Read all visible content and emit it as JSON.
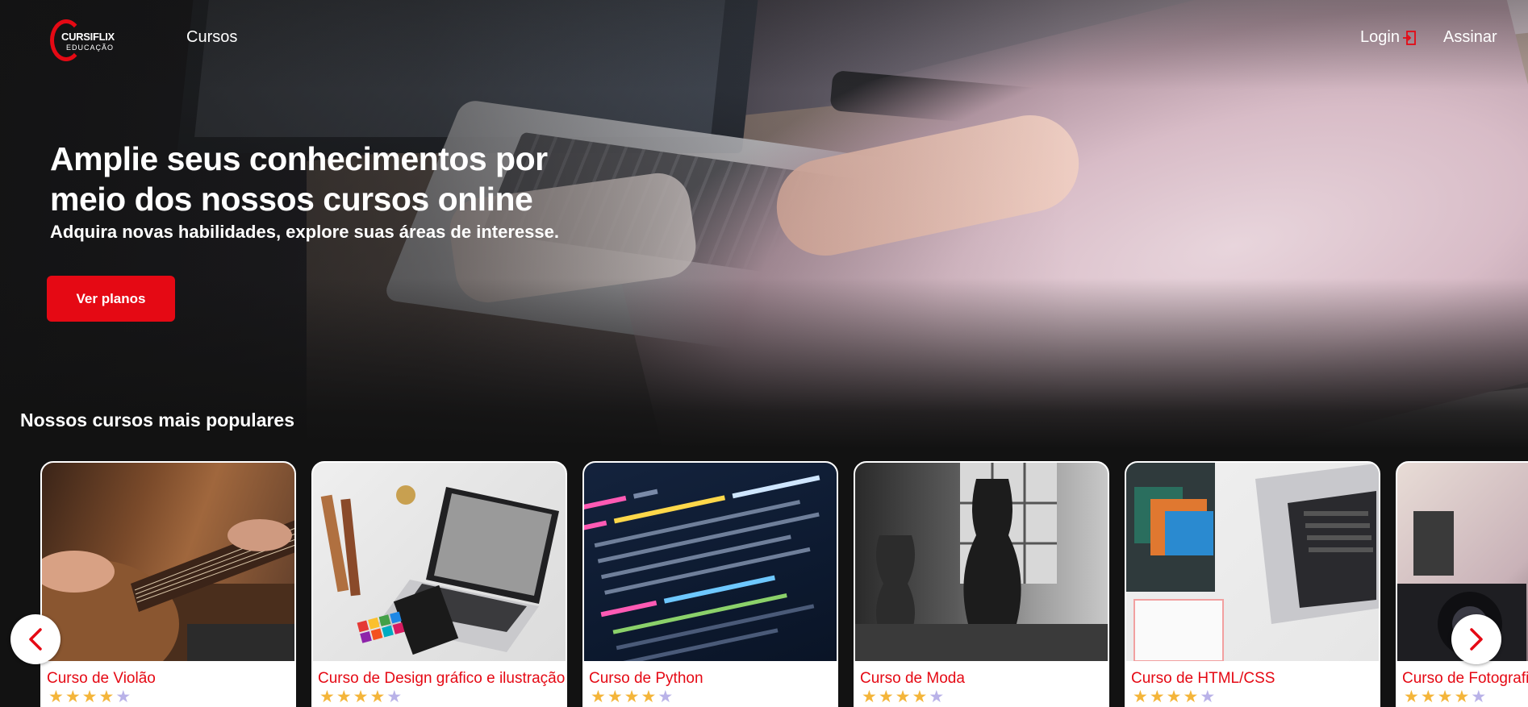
{
  "brand": {
    "top": "CURSIFLIX",
    "bottom": "EDUCAÇÃO",
    "accent": "#e50914"
  },
  "nav": {
    "cursos": "Cursos",
    "login": "Login",
    "login_icon": "login-icon",
    "assinar": "Assinar"
  },
  "hero": {
    "title": "Amplie seus conhecimentos por meio dos nossos cursos online",
    "subtitle": "Adquira novas habilidades, explore suas áreas de interesse.",
    "cta": "Ver planos"
  },
  "section": {
    "title": "Nossos cursos mais populares"
  },
  "courses": [
    {
      "title": "Curso de Violão",
      "rating": 4,
      "max": 5
    },
    {
      "title": "Curso de Design gráfico e ilustração",
      "rating": 4,
      "max": 5
    },
    {
      "title": "Curso de Python",
      "rating": 4,
      "max": 5
    },
    {
      "title": "Curso de Moda",
      "rating": 4,
      "max": 5
    },
    {
      "title": "Curso de HTML/CSS",
      "rating": 4,
      "max": 5
    },
    {
      "title": "Curso de Fotografia",
      "rating": 4,
      "max": 5
    }
  ],
  "carousel": {
    "prev_icon": "chevron-left-icon",
    "next_icon": "chevron-right-icon"
  }
}
